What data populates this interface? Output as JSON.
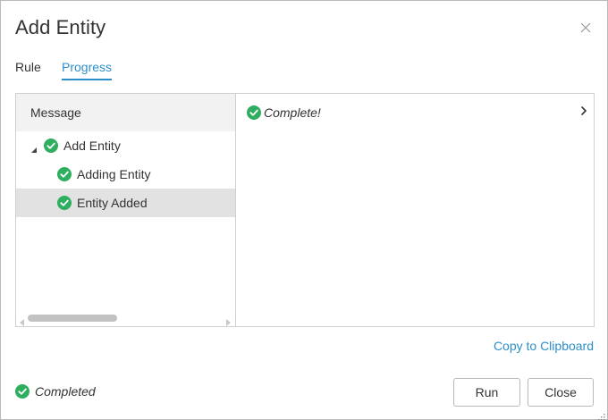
{
  "dialog": {
    "title": "Add Entity"
  },
  "tabs": [
    {
      "label": "Rule",
      "active": false
    },
    {
      "label": "Progress",
      "active": true
    }
  ],
  "tree": {
    "column_header": "Message",
    "items": [
      {
        "label": "Add Entity",
        "status": "check-circle-icon",
        "expanded": true
      },
      {
        "label": "Adding Entity",
        "status": "check-circle-icon"
      },
      {
        "label": "Entity Added",
        "status": "check-circle-icon",
        "selected": true
      }
    ]
  },
  "detail": {
    "text": "Complete!"
  },
  "copy_link": "Copy to Clipboard",
  "status": {
    "text": "Completed"
  },
  "buttons": {
    "run": "Run",
    "close": "Close"
  },
  "colors": {
    "accent": "#2c8fc9",
    "success": "#2eae5e",
    "selected_row": "#e2e2e2",
    "header_bg": "#f2f2f2"
  }
}
